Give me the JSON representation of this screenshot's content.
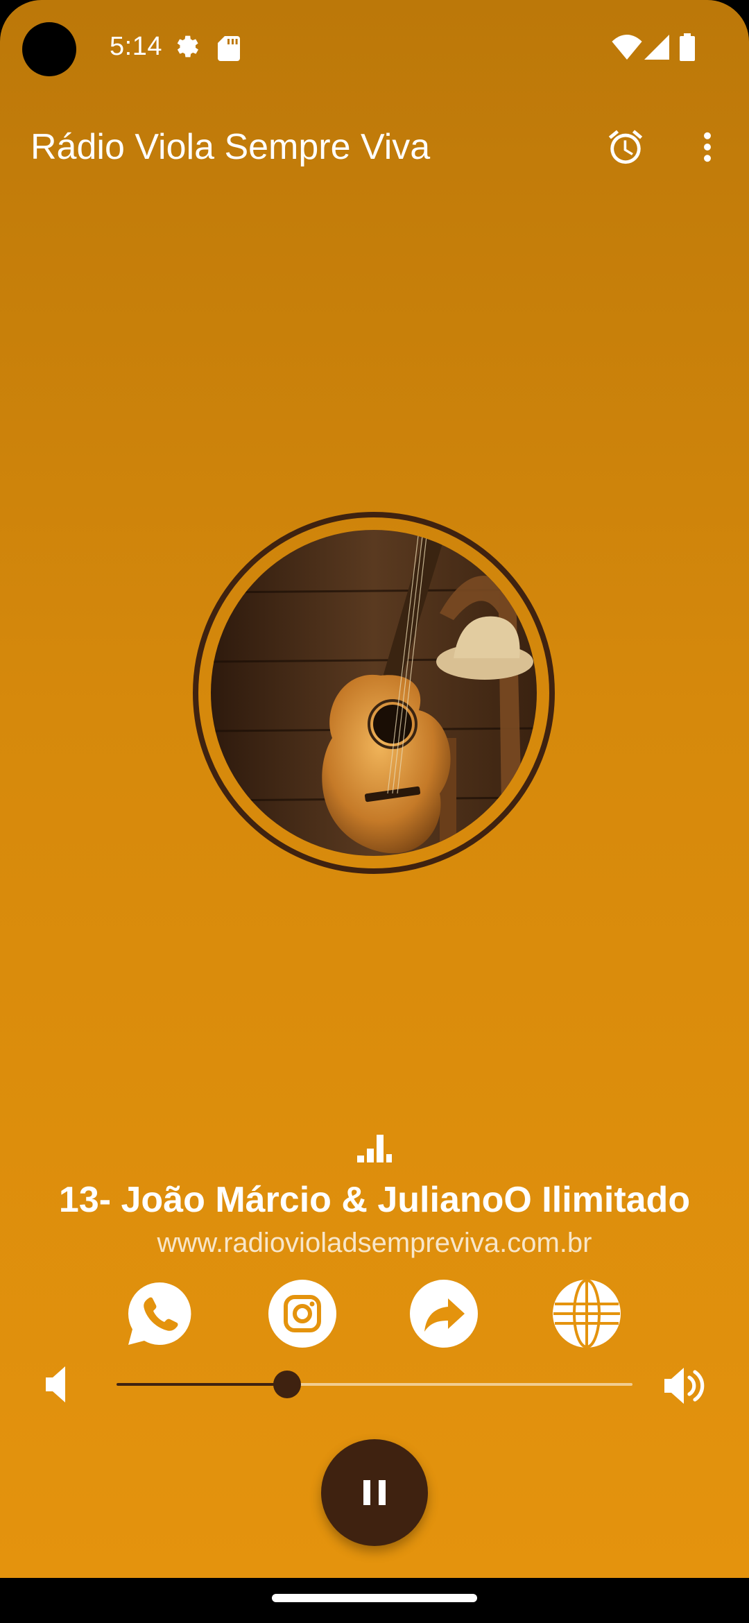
{
  "status_bar": {
    "time": "5:14",
    "icons": [
      "settings-gear-icon",
      "sd-card-icon",
      "wifi-icon",
      "signal-icon",
      "battery-icon"
    ]
  },
  "app_bar": {
    "title": "Rádio Viola Sempre Viva",
    "actions": [
      "alarm-clock-icon",
      "more-vert-icon"
    ]
  },
  "artwork": {
    "description_icon": "album-art-guitar-icon"
  },
  "now_playing": {
    "track_title": "13- João Márcio & JulianoO Ilimitado",
    "website": "www.radiovioladsempreviva.com.br"
  },
  "social_buttons": [
    "whatsapp-icon",
    "instagram-icon",
    "share-icon",
    "globe-icon"
  ],
  "volume": {
    "level": 0.33,
    "min_icon": "volume-low-icon",
    "max_icon": "volume-high-icon"
  },
  "player": {
    "state_icon": "pause-icon"
  },
  "colors": {
    "background_top": "#bc7809",
    "background_bottom": "#e4930d",
    "accent_dark": "#3f2210",
    "text": "#ffffff"
  }
}
